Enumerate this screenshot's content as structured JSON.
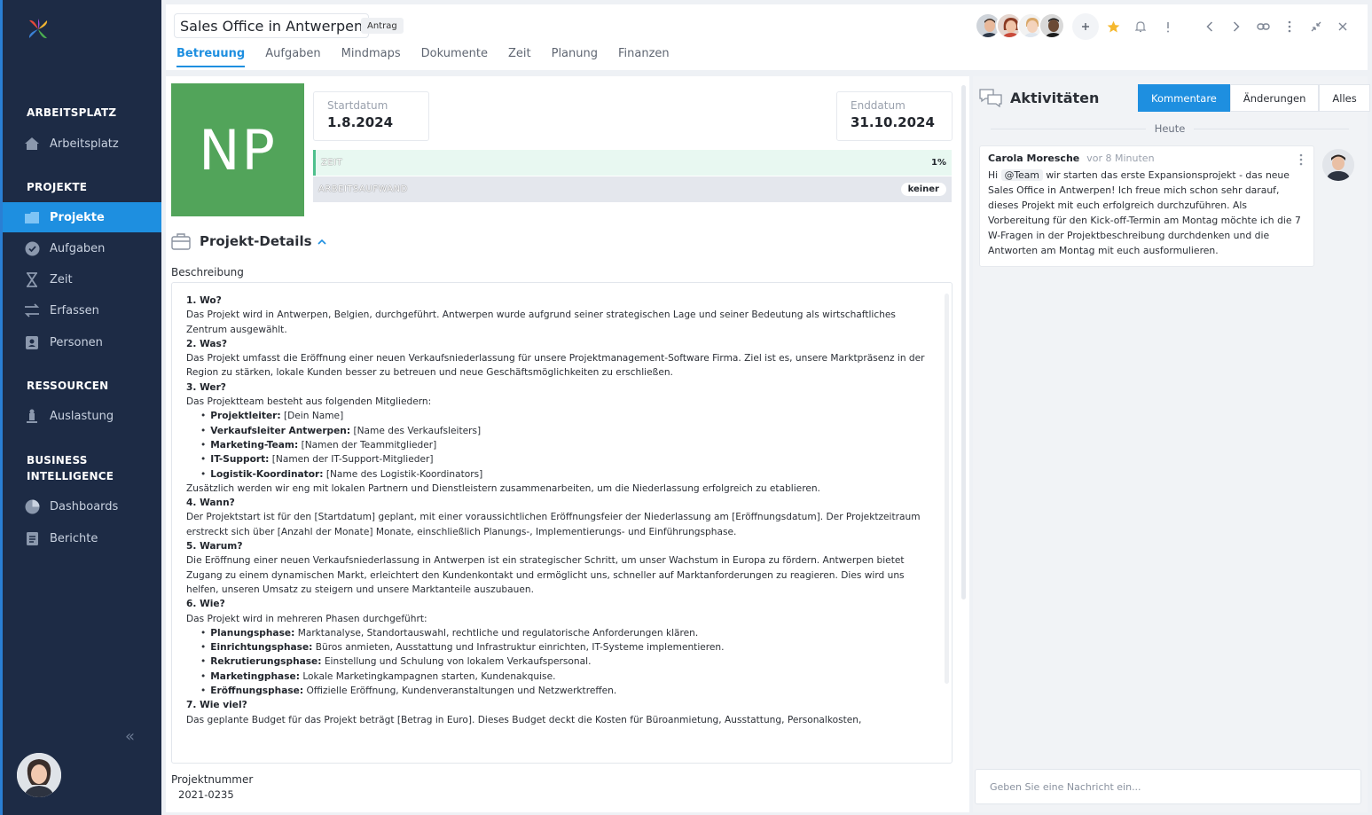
{
  "sidebar": {
    "sections": [
      {
        "title": "ARBEITSPLATZ",
        "items": [
          {
            "label": "Arbeitsplatz",
            "icon": "home-icon"
          }
        ]
      },
      {
        "title": "PROJEKTE",
        "items": [
          {
            "label": "Projekte",
            "icon": "folder-icon",
            "active": true
          },
          {
            "label": "Aufgaben",
            "icon": "check-circle-icon"
          },
          {
            "label": "Zeit",
            "icon": "hourglass-icon"
          },
          {
            "label": "Erfassen",
            "icon": "transfer-icon"
          },
          {
            "label": "Personen",
            "icon": "contact-card-icon"
          }
        ]
      },
      {
        "title": "RESSOURCEN",
        "items": [
          {
            "label": "Auslastung",
            "icon": "person-stand-icon"
          }
        ]
      },
      {
        "title": "BUSINESS INTELLIGENCE",
        "items": [
          {
            "label": "Dashboards",
            "icon": "pie-chart-icon"
          },
          {
            "label": "Berichte",
            "icon": "report-icon"
          }
        ]
      }
    ],
    "collapse_glyph": "«"
  },
  "header": {
    "title": "Sales Office in Antwerpen",
    "badge": "Antrag",
    "tabs": [
      "Betreuung",
      "Aufgaben",
      "Mindmaps",
      "Dokumente",
      "Zeit",
      "Planung",
      "Finanzen"
    ],
    "active_tab": "Betreuung",
    "icons": [
      "add-icon",
      "star-icon",
      "bell-icon",
      "alert-icon",
      "chevron-left-icon",
      "chevron-right-icon",
      "link-icon",
      "more-vertical-icon",
      "minimize-icon",
      "close-icon"
    ]
  },
  "project": {
    "initials": "NP",
    "tile_color": "#52a45a",
    "start_label": "Startdatum",
    "start_value": "1.8.2024",
    "end_label": "Enddatum",
    "end_value": "31.10.2024",
    "zeit_label": "ZEIT",
    "zeit_value": "1%",
    "aufwand_label": "ARBEITSAUFWAND",
    "aufwand_value": "keiner",
    "details_title": "Projekt-Details",
    "description_label": "Beschreibung",
    "number_label": "Projektnummer",
    "number_value": "2021-0235"
  },
  "description": {
    "h1": "1. Wo?",
    "p1": "Das Projekt wird in Antwerpen, Belgien, durchgeführt. Antwerpen wurde aufgrund seiner strategischen Lage und seiner Bedeutung als wirtschaftliches Zentrum ausgewählt.",
    "h2": "2. Was?",
    "p2": "Das Projekt umfasst die Eröffnung einer neuen Verkaufsniederlassung für unsere Projektmanagement-Software Firma. Ziel ist es, unsere Marktpräsenz in der Region zu stärken, lokale Kunden besser zu betreuen und neue Geschäftsmöglichkeiten zu erschließen.",
    "h3": "3. Wer?",
    "p3": "Das Projektteam besteht aus folgenden Mitgliedern:",
    "team": [
      {
        "role": "Projektleiter:",
        "name": "[Dein Name]"
      },
      {
        "role": "Verkaufsleiter Antwerpen:",
        "name": "[Name des Verkaufsleiters]"
      },
      {
        "role": "Marketing-Team:",
        "name": "[Namen der Teammitglieder]"
      },
      {
        "role": "IT-Support:",
        "name": "[Namen der IT-Support-Mitglieder]"
      },
      {
        "role": "Logistik-Koordinator:",
        "name": "[Name des Logistik-Koordinators]"
      }
    ],
    "p3b": "Zusätzlich werden wir eng mit lokalen Partnern und Dienstleistern zusammenarbeiten, um die Niederlassung erfolgreich zu etablieren.",
    "h4": "4. Wann?",
    "p4": "Der Projektstart ist für den [Startdatum] geplant, mit einer voraussichtlichen Eröffnungsfeier der Niederlassung am [Eröffnungsdatum]. Der Projektzeitraum erstreckt sich über [Anzahl der Monate] Monate, einschließlich Planungs-, Implementierungs- und Einführungsphase.",
    "h5": "5. Warum?",
    "p5": "Die Eröffnung einer neuen Verkaufsniederlassung in Antwerpen ist ein strategischer Schritt, um unser Wachstum in Europa zu fördern. Antwerpen bietet Zugang zu einem dynamischen Markt, erleichtert den Kundenkontakt und ermöglicht uns, schneller auf Marktanforderungen zu reagieren. Dies wird uns helfen, unseren Umsatz zu steigern und unsere Marktanteile auszubauen.",
    "h6": "6. Wie?",
    "p6": "Das Projekt wird in mehreren Phasen durchgeführt:",
    "phases": [
      {
        "role": "Planungsphase:",
        "name": "Marktanalyse, Standortauswahl, rechtliche und regulatorische Anforderungen klären."
      },
      {
        "role": "Einrichtungsphase:",
        "name": "Büros anmieten, Ausstattung und Infrastruktur einrichten, IT-Systeme implementieren."
      },
      {
        "role": "Rekrutierungsphase:",
        "name": "Einstellung und Schulung von lokalem Verkaufspersonal."
      },
      {
        "role": "Marketingphase:",
        "name": "Lokale Marketingkampagnen starten, Kundenakquise."
      },
      {
        "role": "Eröffnungsphase:",
        "name": "Offizielle Eröffnung, Kundenveranstaltungen und Netzwerktreffen."
      }
    ],
    "h7": "7. Wie viel?",
    "p7": "Das geplante Budget für das Projekt beträgt [Betrag in Euro]. Dieses Budget deckt die Kosten für Büroanmietung, Ausstattung, Personalkosten,"
  },
  "activity": {
    "title": "Aktivitäten",
    "filters": [
      "Kommentare",
      "Änderungen",
      "Alles"
    ],
    "active_filter": "Kommentare",
    "day": "Heute",
    "comment": {
      "author": "Carola Moresche",
      "time": "vor 8 Minuten",
      "prefix": "Hi",
      "mention": "@Team",
      "text": "wir starten das erste Expansionsprojekt - das neue Sales Office in Antwerpen! Ich freue mich schon sehr darauf, dieses Projekt mit euch erfolgreich durchzuführen. Als Vorbereitung für den Kick-off-Termin am Montag möchte ich die 7 W-Fragen in der Projektbeschreibung durchdenken und die Antworten am Montag mit euch ausformulieren."
    },
    "input_placeholder": "Geben Sie eine Nachricht ein..."
  }
}
